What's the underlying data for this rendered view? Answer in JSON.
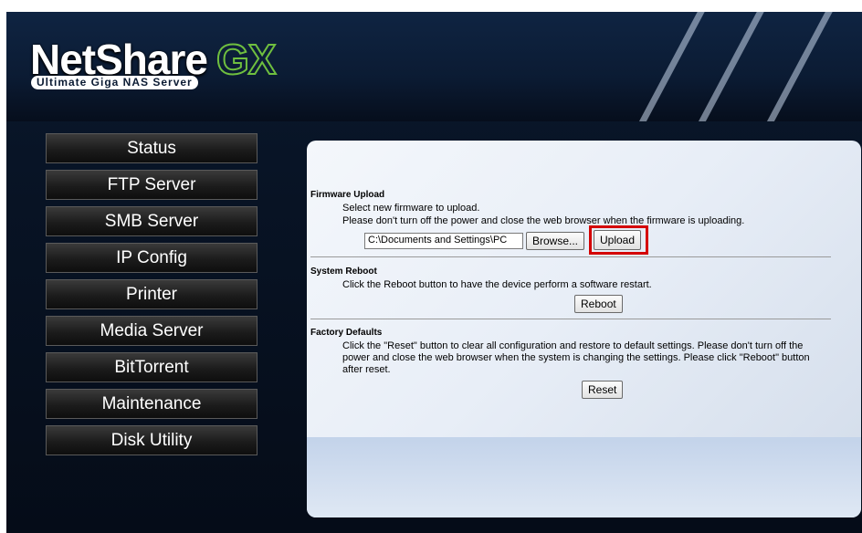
{
  "logo": {
    "name_main": "NetShare",
    "name_suffix": "GX",
    "tagline": "Ultimate Giga NAS Server"
  },
  "nav": {
    "items": [
      {
        "label": "Status"
      },
      {
        "label": "FTP Server"
      },
      {
        "label": "SMB Server"
      },
      {
        "label": "IP Config"
      },
      {
        "label": "Printer"
      },
      {
        "label": "Media Server"
      },
      {
        "label": "BitTorrent"
      },
      {
        "label": "Maintenance"
      },
      {
        "label": "Disk Utility"
      }
    ]
  },
  "firmware": {
    "title": "Firmware Upload",
    "line1": "Select new firmware to upload.",
    "line2": "Please don't turn off the power and close the web browser when the firmware is uploading.",
    "file_value": "C:\\Documents and Settings\\PC",
    "browse_label": "Browse...",
    "upload_label": "Upload"
  },
  "reboot": {
    "title": "System Reboot",
    "desc": "Click the Reboot button to have the device perform a software restart.",
    "button_label": "Reboot"
  },
  "factory": {
    "title": "Factory Defaults",
    "desc": "Click the \"Reset\" button to clear all configuration and restore to default settings. Please don't turn off the power and close the web browser when the system is changing the settings. Please click \"Reboot\" button after reset.",
    "button_label": "Reset"
  },
  "colors": {
    "highlight": "#d40000",
    "logo_accent": "#6fbf3f"
  }
}
